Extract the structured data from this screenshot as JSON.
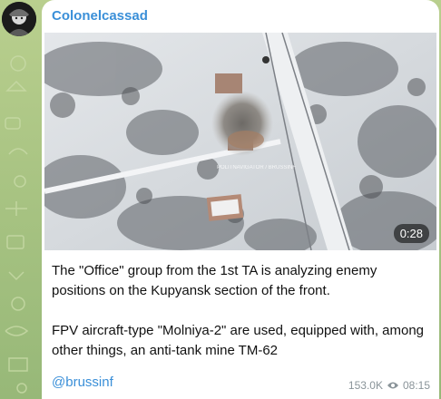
{
  "channel": {
    "name": "Colonelcassad"
  },
  "video": {
    "duration": "0:28",
    "watermark": "POLITNAVIGATOR / BRUSSINF"
  },
  "caption": {
    "paragraph_1": "The \"Office\" group from the 1st TA is analyzing enemy positions on the Kupyansk section of the front.",
    "paragraph_2": "FPV aircraft-type \"Molniya-2\" are used, equipped with, among other things, an anti-tank mine TM-62"
  },
  "footer": {
    "signature": "@brussinf",
    "views": "153.0K",
    "time": "08:15"
  },
  "colors": {
    "link": "#3a8fd8",
    "background": "#a9c483",
    "bubble": "#ffffff"
  },
  "icons": [
    "avatar",
    "eye-icon",
    "play-video"
  ]
}
